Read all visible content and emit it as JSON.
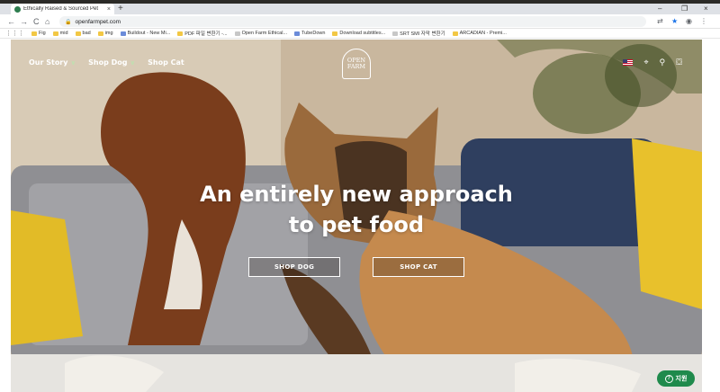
{
  "browser": {
    "tab_title": "Ethically Raised & Sourced Pet",
    "tab_close": "×",
    "new_tab": "+",
    "window_controls": [
      "–",
      "❐",
      "×"
    ],
    "url": "openfarmpet.com",
    "nav": {
      "back": "←",
      "forward": "→",
      "reload": "C",
      "home": "⌂"
    },
    "toolbar_icons": [
      "translate-icon",
      "star-icon",
      "profile-icon",
      "menu-icon"
    ],
    "bookmarks": [
      {
        "label": "Fig",
        "icon": "folder-icon"
      },
      {
        "label": "mid",
        "icon": "folder-icon"
      },
      {
        "label": "bad",
        "icon": "folder-icon"
      },
      {
        "label": "img",
        "icon": "folder-icon"
      },
      {
        "label": "Buildout - New Mi...",
        "icon": "grid-icon"
      },
      {
        "label": "PDF 파일 변환기 -...",
        "icon": "folder-icon"
      },
      {
        "label": "Open Farm Ethical...",
        "icon": "doc-icon"
      },
      {
        "label": "TubeDown",
        "icon": "grid-icon"
      },
      {
        "label": "Download subtitles...",
        "icon": "folder-icon"
      },
      {
        "label": "SRT SMI 자막 변환기",
        "icon": "doc-icon"
      },
      {
        "label": "ARCADIAN - Premi...",
        "icon": "folder-icon"
      }
    ]
  },
  "site": {
    "nav_links": [
      {
        "label": "Our Story",
        "has_dropdown": true
      },
      {
        "label": "Shop Dog",
        "has_dropdown": true
      },
      {
        "label": "Shop Cat",
        "has_dropdown": false
      }
    ],
    "logo_lines": [
      "OPEN",
      "FARM"
    ],
    "headline_line1": "An entirely new approach",
    "headline_line2": "to pet food",
    "cta_dog": "SHOP DOG",
    "cta_cat": "SHOP CAT",
    "help_label": "지원",
    "help_icon": "?"
  },
  "colors": {
    "brand_green": "#1f8a4c",
    "hero_text": "#ffffff"
  }
}
